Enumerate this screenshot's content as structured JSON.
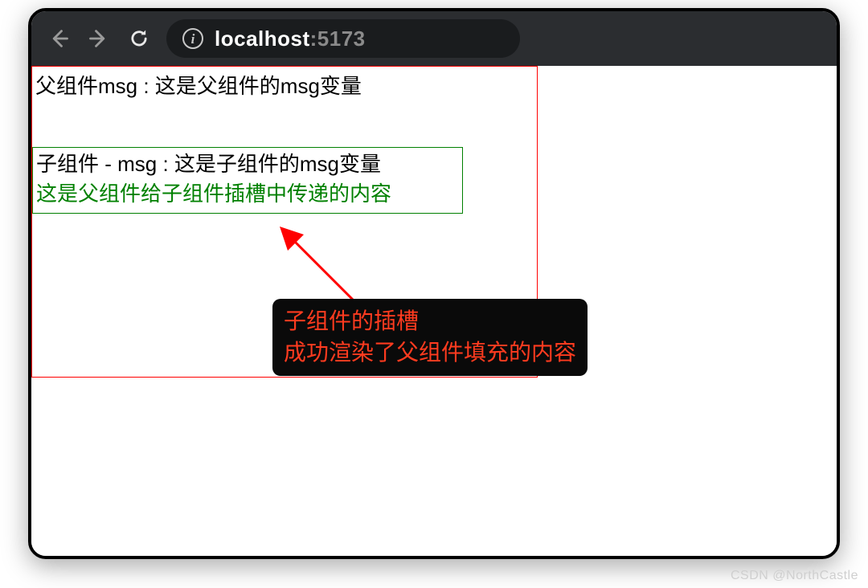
{
  "browser": {
    "url_host": "localhost",
    "url_port": ":5173"
  },
  "page": {
    "parent_msg": "父组件msg : 这是父组件的msg变量",
    "child_msg": "子组件 - msg : 这是子组件的msg变量",
    "slot_content": "这是父组件给子组件插槽中传递的内容"
  },
  "annotation": {
    "line1": "子组件的插槽",
    "line2": "成功渲染了父组件填充的内容"
  },
  "watermark": "CSDN @NorthCastle",
  "icons": {
    "back": "back-arrow-icon",
    "forward": "forward-arrow-icon",
    "reload": "reload-icon",
    "info": "info-icon"
  },
  "colors": {
    "toolbar_bg": "#2b2d30",
    "address_bg": "#1a1c1e",
    "parent_border": "#ff0000",
    "child_border": "#008000",
    "slot_text": "#008000",
    "annotation_bg": "#0a0a0a",
    "annotation_text": "#ff3b1f",
    "arrow": "#ff0000"
  }
}
